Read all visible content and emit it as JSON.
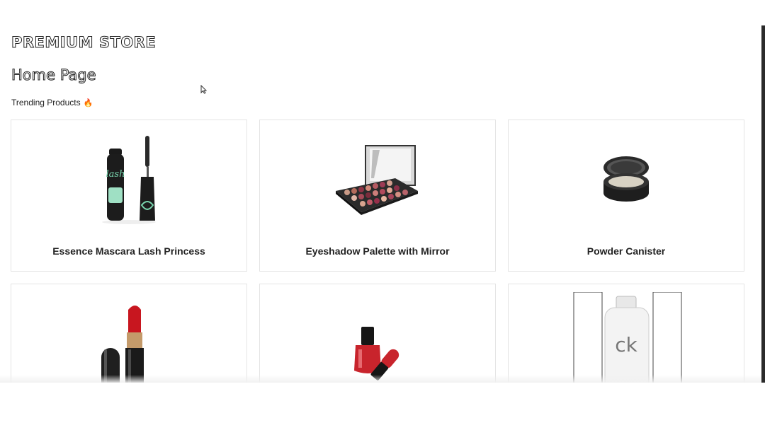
{
  "store": {
    "brand": "PREMIUM STORE",
    "page_title": "Home Page"
  },
  "section": {
    "title": "Trending Products",
    "emoji": "🔥"
  },
  "products": [
    {
      "name": "Essence Mascara Lash Princess",
      "icon": "mascara"
    },
    {
      "name": "Eyeshadow Palette with Mirror",
      "icon": "eyeshadow-palette"
    },
    {
      "name": "Powder Canister",
      "icon": "powder-canister"
    },
    {
      "name": "",
      "icon": "lipstick"
    },
    {
      "name": "",
      "icon": "nail-polish"
    },
    {
      "name": "",
      "icon": "perfume-bottle"
    }
  ],
  "colors": {
    "text": "#222222",
    "card_border": "#e4e4e4",
    "scrollbar": "#2b2b2b"
  }
}
